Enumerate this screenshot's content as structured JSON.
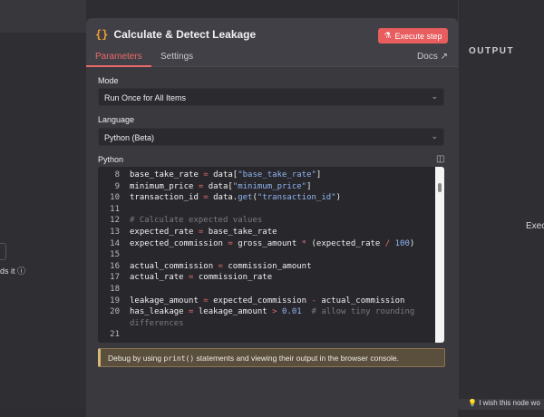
{
  "left_panel": {
    "hint": "ds it"
  },
  "right_panel": {
    "title": "OUTPUT",
    "exec_text": "Exec",
    "wish_text": "I wish this node wo"
  },
  "modal": {
    "title": "Calculate & Detect Leakage",
    "execute_label": "Execute step",
    "tabs": [
      {
        "label": "Parameters"
      },
      {
        "label": "Settings"
      }
    ],
    "docs_label": "Docs",
    "mode": {
      "label": "Mode",
      "value": "Run Once for All Items"
    },
    "language": {
      "label": "Language",
      "value": "Python (Beta)"
    },
    "code_label": "Python",
    "code_lines": [
      {
        "n": "8",
        "html": "base_take_rate <span class=o>=</span> data[<span class=s>\"base_take_rate\"</span>]"
      },
      {
        "n": "9",
        "html": "minimum_price <span class=o>=</span> data[<span class=s>\"minimum_price\"</span>]"
      },
      {
        "n": "10",
        "html": "transaction_id <span class=o>=</span> data.<span class=s>get</span>(<span class=s>\"transaction_id\"</span>)"
      },
      {
        "n": "11",
        "html": ""
      },
      {
        "n": "12",
        "html": "<span class=c># Calculate expected values</span>"
      },
      {
        "n": "13",
        "html": "expected_rate <span class=o>=</span> base_take_rate"
      },
      {
        "n": "14",
        "html": "expected_commission <span class=o>=</span> gross_amount <span class=o>*</span> (expected_rate <span class=o>/</span> <span class=n>100</span>)"
      },
      {
        "n": "15",
        "html": ""
      },
      {
        "n": "16",
        "html": "actual_commission <span class=o>=</span> commission_amount"
      },
      {
        "n": "17",
        "html": "actual_rate <span class=o>=</span> commission_rate"
      },
      {
        "n": "18",
        "html": ""
      },
      {
        "n": "19",
        "html": "leakage_amount <span class=o>=</span> expected_commission <span class=o>-</span> actual_commission"
      },
      {
        "n": "20",
        "html": "has_leakage <span class=o>=</span> leakage_amount <span class=o>&gt;</span> <span class=n>0.01</span>  <span class=c># allow tiny rounding</span>"
      },
      {
        "n": "",
        "html": "<span class=c>differences</span>"
      },
      {
        "n": "21",
        "html": ""
      }
    ],
    "info": {
      "pre": "Debug by using ",
      "code": "print()",
      "post": " statements and viewing their output in the browser console."
    }
  }
}
